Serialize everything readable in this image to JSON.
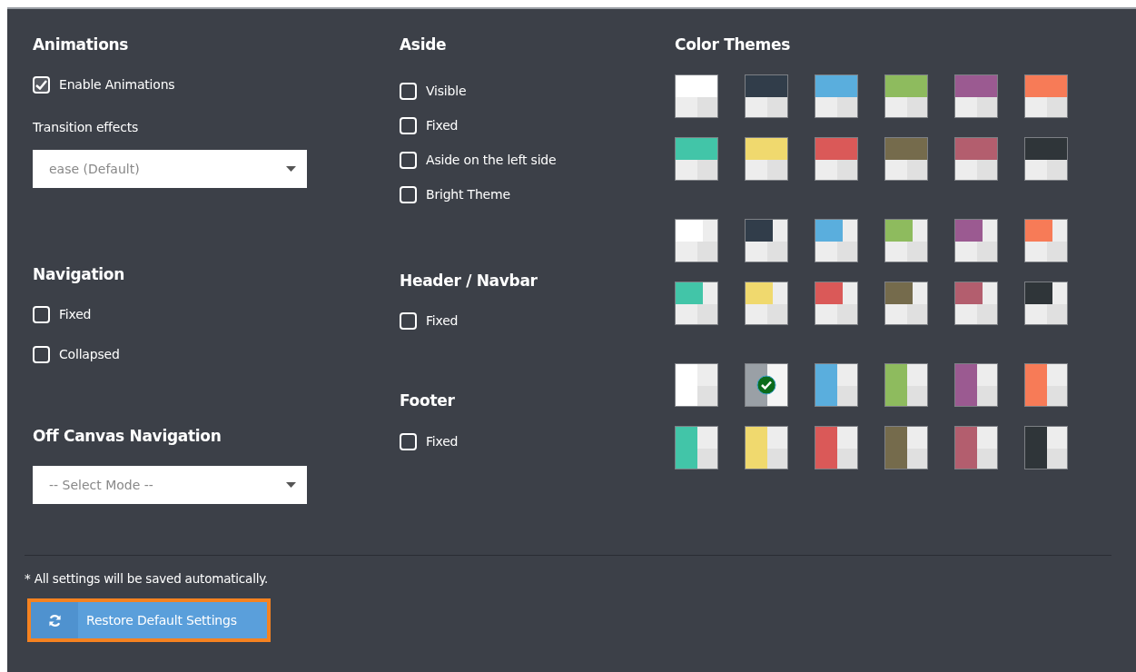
{
  "columns": [
    [
      {
        "title": "Animations",
        "controls": [
          {
            "kind": "checkbox",
            "label": "Enable Animations",
            "checked": true
          },
          {
            "kind": "label",
            "text": "Transition effects"
          },
          {
            "kind": "select",
            "value": "ease (Default)"
          }
        ]
      },
      {
        "title": "Navigation",
        "controls": [
          {
            "kind": "checkbox",
            "label": "Fixed",
            "checked": false
          },
          {
            "kind": "checkbox",
            "label": "Collapsed",
            "checked": false
          }
        ]
      },
      {
        "title": "Off Canvas Navigation",
        "controls": [
          {
            "kind": "select",
            "value": "-- Select Mode --"
          }
        ]
      }
    ],
    [
      {
        "title": "Aside",
        "controls": [
          {
            "kind": "checkbox",
            "label": "Visible",
            "checked": false
          },
          {
            "kind": "checkbox",
            "label": "Fixed",
            "checked": false
          },
          {
            "kind": "checkbox",
            "label": "Aside on the left side",
            "checked": false
          },
          {
            "kind": "checkbox",
            "label": "Bright Theme",
            "checked": false
          }
        ]
      },
      {
        "title": "Header / Navbar",
        "controls": [
          {
            "kind": "checkbox",
            "label": "Fixed",
            "checked": false
          }
        ]
      },
      {
        "title": "Footer",
        "controls": [
          {
            "kind": "checkbox",
            "label": "Fixed",
            "checked": false
          }
        ]
      }
    ]
  ],
  "color_themes": {
    "title": "Color Themes",
    "groups": [
      {
        "kind": "top",
        "swatches": [
          {
            "color": "#ffffff",
            "selected": false
          },
          {
            "color": "#313d4a",
            "selected": false
          },
          {
            "color": "#5aaedd",
            "selected": false
          },
          {
            "color": "#8ebb5e",
            "selected": false
          },
          {
            "color": "#9b5a91",
            "selected": false
          },
          {
            "color": "#f77b57",
            "selected": false
          },
          {
            "color": "#42c5a8",
            "selected": false
          },
          {
            "color": "#f0d96e",
            "selected": false
          },
          {
            "color": "#da5958",
            "selected": false
          },
          {
            "color": "#756b4c",
            "selected": false
          },
          {
            "color": "#b35e6e",
            "selected": false
          },
          {
            "color": "#2f3539",
            "selected": false
          }
        ]
      },
      {
        "kind": "corner",
        "swatches": [
          {
            "color": "#ffffff",
            "selected": false
          },
          {
            "color": "#313d4a",
            "selected": false
          },
          {
            "color": "#5aaedd",
            "selected": false
          },
          {
            "color": "#8ebb5e",
            "selected": false
          },
          {
            "color": "#9b5a91",
            "selected": false
          },
          {
            "color": "#f77b57",
            "selected": false
          },
          {
            "color": "#42c5a8",
            "selected": false
          },
          {
            "color": "#f0d96e",
            "selected": false
          },
          {
            "color": "#da5958",
            "selected": false
          },
          {
            "color": "#756b4c",
            "selected": false
          },
          {
            "color": "#b35e6e",
            "selected": false
          },
          {
            "color": "#2f3539",
            "selected": false
          }
        ]
      },
      {
        "kind": "side",
        "swatches": [
          {
            "color": "#ffffff",
            "selected": false
          },
          {
            "color": "#9aa0a6",
            "selected": true
          },
          {
            "color": "#5aaedd",
            "selected": false
          },
          {
            "color": "#8ebb5e",
            "selected": false
          },
          {
            "color": "#9b5a91",
            "selected": false
          },
          {
            "color": "#f77b57",
            "selected": false
          },
          {
            "color": "#42c5a8",
            "selected": false
          },
          {
            "color": "#f0d96e",
            "selected": false
          },
          {
            "color": "#da5958",
            "selected": false
          },
          {
            "color": "#756b4c",
            "selected": false
          },
          {
            "color": "#b35e6e",
            "selected": false
          },
          {
            "color": "#2f3539",
            "selected": false
          }
        ]
      }
    ]
  },
  "footer": {
    "note": "* All settings will be saved automatically.",
    "button": {
      "label": "Restore Default Settings",
      "focused": true
    }
  }
}
